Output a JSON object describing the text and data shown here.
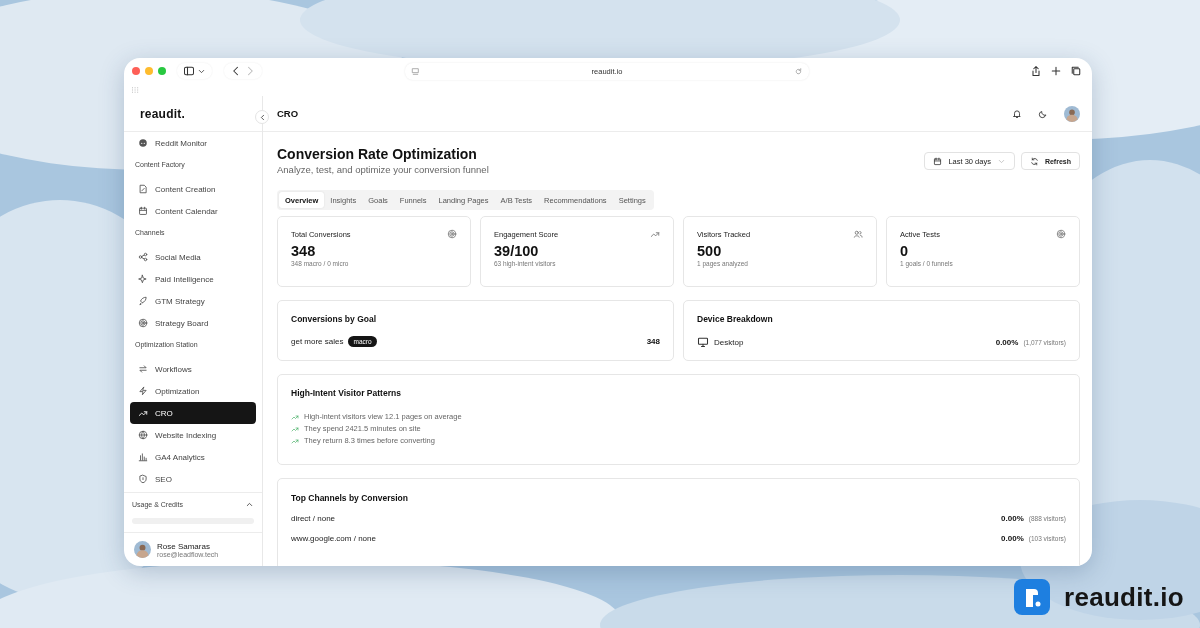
{
  "browser": {
    "url": "reaudit.io"
  },
  "sidebar": {
    "logo": "reaudit.",
    "sections": [
      {
        "items": [
          {
            "label": "Reddit Monitor",
            "selected": false
          }
        ]
      },
      {
        "heading": "Content Factory",
        "items": [
          {
            "label": "Content Creation",
            "selected": false
          },
          {
            "label": "Content Calendar",
            "selected": false
          }
        ]
      },
      {
        "heading": "Channels",
        "items": [
          {
            "label": "Social Media",
            "selected": false
          },
          {
            "label": "Paid Intelligence",
            "selected": false
          },
          {
            "label": "GTM Strategy",
            "selected": false
          },
          {
            "label": "Strategy Board",
            "selected": false
          }
        ]
      },
      {
        "heading": "Optimization Station",
        "items": [
          {
            "label": "Workflows",
            "selected": false
          },
          {
            "label": "Optimization",
            "selected": false
          },
          {
            "label": "CRO",
            "selected": true
          },
          {
            "label": "Website Indexing",
            "selected": false
          },
          {
            "label": "GA4 Analytics",
            "selected": false
          },
          {
            "label": "SEO",
            "selected": false
          }
        ]
      }
    ],
    "usage": {
      "title": "Usage & Credits",
      "expanded": true
    },
    "user": {
      "name": "Rose Samaras",
      "email": "rose@leadflow.tech"
    }
  },
  "header": {
    "title": "CRO"
  },
  "page": {
    "title": "Conversion Rate Optimization",
    "subtitle": "Analyze, test, and optimize your conversion funnel",
    "date_range": "Last 30 days",
    "refresh": "Refresh"
  },
  "tabs": [
    {
      "label": "Overview",
      "selected": true
    },
    {
      "label": "Insights",
      "selected": false
    },
    {
      "label": "Goals",
      "selected": false
    },
    {
      "label": "Funnels",
      "selected": false
    },
    {
      "label": "Landing Pages",
      "selected": false
    },
    {
      "label": "A/B Tests",
      "selected": false
    },
    {
      "label": "Recommendations",
      "selected": false
    },
    {
      "label": "Settings",
      "selected": false
    }
  ],
  "stats": [
    {
      "title": "Total Conversions",
      "value": "348",
      "note": "348 macro / 0 micro"
    },
    {
      "title": "Engagement Score",
      "value": "39/100",
      "note": "63 high-intent visitors"
    },
    {
      "title": "Visitors Tracked",
      "value": "500",
      "note": "1 pages analyzed"
    },
    {
      "title": "Active Tests",
      "value": "0",
      "note": "1 goals / 0 funnels"
    }
  ],
  "goals": {
    "title": "Conversions by Goal",
    "rows": [
      {
        "name": "get more sales",
        "tag": "macro",
        "count": "348"
      }
    ]
  },
  "devices": {
    "title": "Device Breakdown",
    "rows": [
      {
        "label": "Desktop",
        "rate": "0.00%",
        "visitors": "(1,077 visitors)"
      }
    ]
  },
  "patterns": {
    "title": "High-Intent Visitor Patterns",
    "items": [
      "High-intent visitors view 12.1 pages on average",
      "They spend 2421.5 minutes on site",
      "They return 8.3 times before converting"
    ]
  },
  "channels": {
    "title": "Top Channels by Conversion",
    "rows": [
      {
        "name": "direct / none",
        "rate": "0.00%",
        "visitors": "(888 visitors)"
      },
      {
        "name": "www.google.com / none",
        "rate": "0.00%",
        "visitors": "(103 visitors)"
      }
    ]
  },
  "brand": {
    "name": "reaudit.io"
  }
}
